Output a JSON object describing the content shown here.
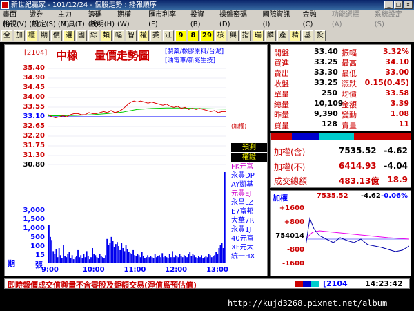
{
  "window": {
    "title": "新世紀贏家 - 101/12/24 - 個股走勢 : 播報順序"
  },
  "menu": {
    "row1": [
      "畫面(I)",
      "證券(E)",
      "主力(M)",
      "籌碼(R)",
      "期權(W)",
      "匯市利率(F)",
      "投資(B)",
      "操盤密碼(D)",
      "國際資訊(I)",
      "金融(C)",
      "功能選擇(A)",
      "系統設定(S)"
    ],
    "row2": [
      "格視(V)",
      "設定(S)",
      "工具(T)",
      "說明(H)"
    ]
  },
  "toolbar": {
    "buttons": [
      "全",
      "加",
      "櫃",
      "期",
      "價",
      "選",
      "國",
      "綜",
      "類",
      "幅",
      "智",
      "權",
      "委",
      "江",
      "9",
      "8",
      "29",
      "核",
      "興",
      "指",
      "瑞",
      "麟",
      "產",
      "精",
      "基",
      "投"
    ]
  },
  "chart": {
    "code": "[2104]",
    "name": "中橡",
    "title": "量價走勢圖",
    "cat1": "[製藥/橡膠原料/台泥]",
    "cat2": "[油電車/新兆生技]",
    "marker": "(加權)",
    "side_top": "期",
    "side_bottom": "張",
    "brokers_title1": "預測",
    "brokers_title2": "權證",
    "brokers": [
      "FK元富",
      "永豐DP",
      "AY凱基",
      "元豐EJ",
      "永昌LZ",
      "E7富邦",
      "大華7R",
      "永豐1J",
      "40元富",
      "XF元大",
      "統一HX"
    ],
    "colors": {
      "accent": "#cc0000",
      "price": "#dd0000",
      "avg": "#00cc00",
      "volume": "#0000ee",
      "ref": "#0000ff"
    }
  },
  "chart_data": {
    "type": "line",
    "price_ticks": [
      "35.40",
      "34.90",
      "34.45",
      "34.00",
      "33.55",
      "33.10",
      "32.65",
      "32.20",
      "31.75",
      "31.30",
      "30.80"
    ],
    "volume_ticks": [
      "3,000",
      "1,500",
      "1,000",
      "500",
      "100",
      "15"
    ],
    "time_ticks": [
      "9:00",
      "10:00",
      "11:00",
      "12:00",
      "13:00"
    ],
    "reference_price": 33.1,
    "ylim": [
      30.8,
      35.4
    ],
    "price": [
      [
        0,
        33.2
      ],
      [
        5,
        33.1
      ],
      [
        10,
        33.05
      ],
      [
        15,
        33.1
      ],
      [
        20,
        33.15
      ],
      [
        25,
        33.1
      ],
      [
        30,
        33.2
      ],
      [
        35,
        33.25
      ],
      [
        40,
        33.25
      ],
      [
        45,
        33.2
      ],
      [
        50,
        33.2
      ],
      [
        55,
        33.3
      ],
      [
        60,
        33.25
      ],
      [
        65,
        33.25
      ],
      [
        70,
        33.3
      ],
      [
        75,
        33.35
      ],
      [
        80,
        33.3
      ],
      [
        85,
        33.4
      ],
      [
        90,
        33.3
      ],
      [
        95,
        33.35
      ],
      [
        100,
        33.45
      ],
      [
        105,
        33.6
      ],
      [
        108,
        33.7
      ],
      [
        112,
        33.8
      ],
      [
        116,
        33.85
      ],
      [
        120,
        33.8
      ],
      [
        125,
        33.85
      ],
      [
        130,
        33.8
      ],
      [
        135,
        33.75
      ],
      [
        140,
        33.8
      ],
      [
        145,
        33.75
      ],
      [
        150,
        33.7
      ],
      [
        155,
        33.65
      ],
      [
        160,
        33.7
      ],
      [
        165,
        33.6
      ],
      [
        170,
        33.55
      ],
      [
        175,
        33.6
      ],
      [
        180,
        33.5
      ],
      [
        185,
        33.55
      ],
      [
        190,
        33.45
      ],
      [
        195,
        33.5
      ],
      [
        200,
        33.45
      ],
      [
        205,
        33.5
      ],
      [
        210,
        33.45
      ],
      [
        215,
        33.4
      ],
      [
        220,
        33.35
      ],
      [
        225,
        33.4
      ],
      [
        230,
        33.3
      ],
      [
        235,
        33.35
      ],
      [
        240,
        33.35
      ]
    ],
    "average": [
      [
        0,
        33.15
      ],
      [
        20,
        33.15
      ],
      [
        40,
        33.17
      ],
      [
        60,
        33.2
      ],
      [
        80,
        33.25
      ],
      [
        100,
        33.32
      ],
      [
        120,
        33.45
      ],
      [
        140,
        33.5
      ],
      [
        160,
        33.52
      ],
      [
        180,
        33.52
      ],
      [
        200,
        33.5
      ],
      [
        220,
        33.48
      ],
      [
        240,
        33.47
      ]
    ],
    "volume": [
      380,
      260,
      230,
      120,
      90,
      140,
      60,
      150,
      80,
      50,
      180,
      70,
      60,
      90,
      110,
      50,
      80,
      40,
      60,
      70,
      130,
      60,
      80,
      50,
      90,
      60,
      120,
      70,
      40,
      60,
      150,
      90,
      80,
      60,
      50,
      90,
      70,
      60,
      50,
      80,
      240,
      180,
      200,
      260,
      220,
      160,
      190,
      210,
      170,
      130,
      200,
      150,
      120,
      180,
      140,
      110,
      100,
      90,
      130,
      80,
      70,
      90,
      80,
      60,
      110,
      70,
      50,
      60,
      80,
      60,
      70,
      60,
      50,
      90,
      60,
      70,
      80,
      60,
      100,
      60,
      70,
      60,
      50,
      90,
      60,
      120,
      60,
      80,
      70,
      60,
      90,
      70,
      60,
      80,
      70,
      60,
      90,
      110,
      70,
      90,
      80,
      60,
      50,
      70,
      60,
      80,
      50,
      60,
      70,
      60,
      90,
      80,
      60,
      70,
      80,
      110,
      90,
      150,
      180,
      200,
      150,
      900
    ]
  },
  "quote": {
    "rows": [
      {
        "l1": "開盤",
        "v1": "33.40",
        "l2": "振幅",
        "v2": "3.32%"
      },
      {
        "l1": "買進",
        "v1": "33.25",
        "l2": "最高",
        "v2": "34.10"
      },
      {
        "l1": "賣出",
        "v1": "33.30",
        "l2": "最低",
        "v2": "33.00"
      },
      {
        "l1": "收盤",
        "v1": "33.25",
        "l2": "漲跌",
        "v2": "0.15(0.45)"
      },
      {
        "l1": "單量",
        "v1": "250",
        "l2": "均價",
        "v2": "33.58"
      },
      {
        "l1": "總量",
        "v1": "10,109",
        "l2": "金額",
        "v2": "3.39"
      },
      {
        "l1": "昨量",
        "v1": "9,390",
        "l2": "變動",
        "v2": "1.08"
      },
      {
        "l1": "買量",
        "v1": "128",
        "l2": "賣量",
        "v2": "11"
      }
    ]
  },
  "index": {
    "r1_label": "加權(含)",
    "r1_value": "7535.52",
    "r1_change": "-4.62",
    "r2_label": "加權(不)",
    "r2_value": "6414.93",
    "r2_change": "-4.04",
    "r3_label": "成交總額",
    "r3_value": "483.13億",
    "r3_change": "18.9"
  },
  "mini": {
    "title": "加權",
    "value": "7535.52",
    "change": "-4.62",
    "pct": "-0.06%",
    "ticks": [
      "+1600",
      "+800",
      "754014",
      "-800",
      "-1600"
    ]
  },
  "footer": {
    "note": "即時報價成交值與量不含零股及鉅額交易(淨值爲預估值)",
    "code": "2104",
    "time": "14:23:42"
  },
  "watermark": "http://kujd3268.pixnet.net/album"
}
